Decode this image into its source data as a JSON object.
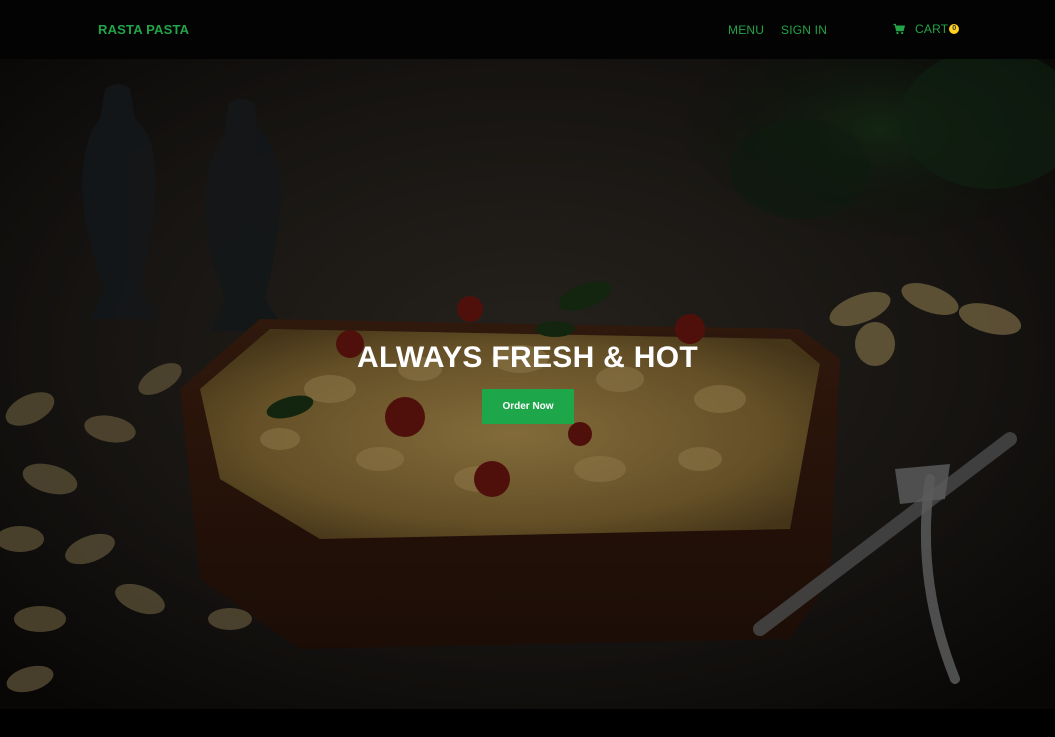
{
  "navbar": {
    "brand": "RASTA PASTA",
    "links": {
      "menu": "MENU",
      "sign_in": "SIGN IN",
      "cart": "CART",
      "cart_count": "0"
    },
    "accent_color": "#22a447",
    "badge_color": "#ffd21f"
  },
  "hero": {
    "title": "ALWAYS FRESH & HOT",
    "cta_label": "Order Now",
    "cta_color": "#1ea64a",
    "background_image": "pasta-bake-dark-photo"
  }
}
